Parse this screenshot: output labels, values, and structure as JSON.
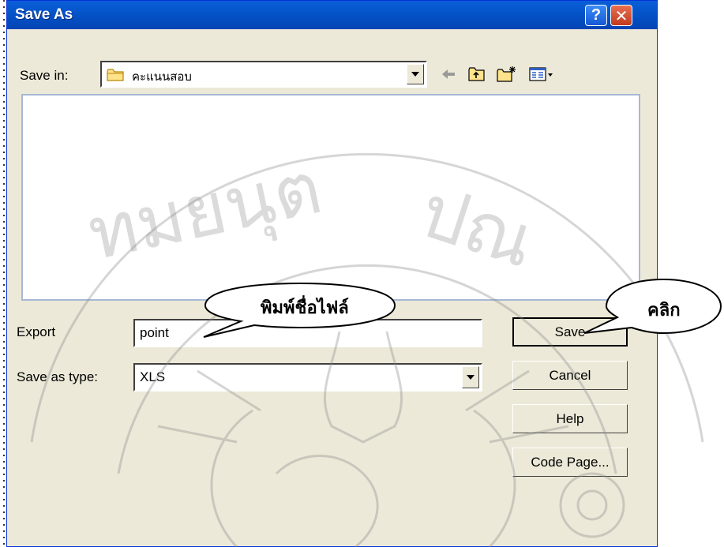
{
  "window": {
    "title": "Save As"
  },
  "title_buttons": {
    "help": "?",
    "close": "✕"
  },
  "save_in": {
    "label": "Save in:",
    "value": "คะแนนสอบ"
  },
  "toolbar_icons": [
    "back-arrow-icon",
    "up-folder-icon",
    "new-folder-icon",
    "view-menu-icon"
  ],
  "export": {
    "label": "Export",
    "value": "point"
  },
  "save_as_type": {
    "label": "Save as type:",
    "value": "XLS"
  },
  "buttons": {
    "save": "Save",
    "cancel": "Cancel",
    "help": "Help",
    "code_page": "Code Page..."
  },
  "callouts": {
    "type_filename": "พิมพ์ชื่อไฟล์",
    "click": "คลิก"
  },
  "watermark_text": "ทมยนุต ปณ",
  "colors": {
    "titlebar": "#0553c9",
    "dialog_bg": "#ece9d8",
    "list_border": "#a6b8d6"
  }
}
